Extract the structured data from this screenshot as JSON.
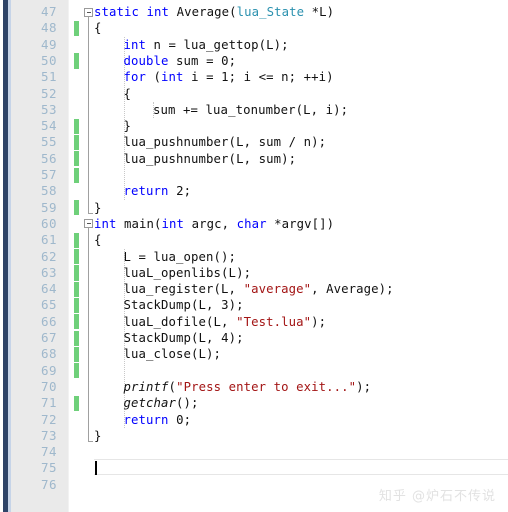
{
  "editor": {
    "app": "visual-studio-code-editor",
    "language": "C",
    "first_visible_line": 47,
    "last_visible_line": 76,
    "current_line": 75,
    "colors": {
      "background": "#ffffff",
      "gutter_background": "#eaeaea",
      "line_number": "#9fb8cc",
      "left_border_navy": "#2e4468",
      "left_border_pale": "#c6d4e8",
      "saved_change_marker": "#6fd07a",
      "keyword": "#0000ff",
      "type": "#2b91af",
      "string": "#a31515",
      "text": "#111111",
      "fold_marker_border": "#9a9a9a",
      "indent_guide": "#c8c8c8",
      "watermark": "#e2e2e2"
    },
    "lines": [
      {
        "n": "47",
        "indent": 0,
        "fold": true,
        "changed": false,
        "tokens": [
          {
            "t": "static",
            "c": "kw"
          },
          {
            "t": " ",
            "c": ""
          },
          {
            "t": "int",
            "c": "kw"
          },
          {
            "t": " Average(",
            "c": ""
          },
          {
            "t": "lua_State",
            "c": "typ"
          },
          {
            "t": " *L)",
            "c": ""
          }
        ]
      },
      {
        "n": "48",
        "indent": 0,
        "fold": false,
        "changed": true,
        "tokens": [
          {
            "t": "{",
            "c": ""
          }
        ]
      },
      {
        "n": "49",
        "indent": 1,
        "fold": false,
        "changed": false,
        "tokens": [
          {
            "t": "int",
            "c": "kw"
          },
          {
            "t": " n = lua_gettop(L);",
            "c": ""
          }
        ]
      },
      {
        "n": "50",
        "indent": 1,
        "fold": false,
        "changed": true,
        "tokens": [
          {
            "t": "double",
            "c": "kw"
          },
          {
            "t": " sum = ",
            "c": ""
          },
          {
            "t": "0",
            "c": "num"
          },
          {
            "t": ";",
            "c": ""
          }
        ]
      },
      {
        "n": "51",
        "indent": 1,
        "fold": false,
        "changed": false,
        "tokens": [
          {
            "t": "for",
            "c": "kw"
          },
          {
            "t": " (",
            "c": ""
          },
          {
            "t": "int",
            "c": "kw"
          },
          {
            "t": " i = ",
            "c": ""
          },
          {
            "t": "1",
            "c": "num"
          },
          {
            "t": "; i <= n; ++i)",
            "c": ""
          }
        ]
      },
      {
        "n": "52",
        "indent": 1,
        "fold": false,
        "changed": false,
        "tokens": [
          {
            "t": "{",
            "c": ""
          }
        ]
      },
      {
        "n": "53",
        "indent": 2,
        "fold": false,
        "changed": false,
        "tokens": [
          {
            "t": "sum += lua_tonumber(L, i);",
            "c": ""
          }
        ]
      },
      {
        "n": "54",
        "indent": 1,
        "fold": false,
        "changed": true,
        "tokens": [
          {
            "t": "}",
            "c": ""
          }
        ]
      },
      {
        "n": "55",
        "indent": 1,
        "fold": false,
        "changed": true,
        "tokens": [
          {
            "t": "lua_pushnumber(L, sum / n);",
            "c": ""
          }
        ]
      },
      {
        "n": "56",
        "indent": 1,
        "fold": false,
        "changed": true,
        "tokens": [
          {
            "t": "lua_pushnumber(L, sum);",
            "c": ""
          }
        ]
      },
      {
        "n": "57",
        "indent": 1,
        "fold": false,
        "changed": true,
        "tokens": []
      },
      {
        "n": "58",
        "indent": 1,
        "fold": false,
        "changed": false,
        "tokens": [
          {
            "t": "return",
            "c": "kw"
          },
          {
            "t": " ",
            "c": ""
          },
          {
            "t": "2",
            "c": "num"
          },
          {
            "t": ";",
            "c": ""
          }
        ]
      },
      {
        "n": "59",
        "indent": 0,
        "fold": false,
        "changed": true,
        "tokens": [
          {
            "t": "}",
            "c": ""
          }
        ]
      },
      {
        "n": "60",
        "indent": 0,
        "fold": true,
        "changed": false,
        "tokens": [
          {
            "t": "int",
            "c": "kw"
          },
          {
            "t": " main(",
            "c": ""
          },
          {
            "t": "int",
            "c": "kw"
          },
          {
            "t": " argc, ",
            "c": ""
          },
          {
            "t": "char",
            "c": "kw"
          },
          {
            "t": " *argv[])",
            "c": ""
          }
        ]
      },
      {
        "n": "61",
        "indent": 0,
        "fold": false,
        "changed": true,
        "tokens": [
          {
            "t": "{",
            "c": ""
          }
        ]
      },
      {
        "n": "62",
        "indent": 1,
        "fold": false,
        "changed": true,
        "tokens": [
          {
            "t": "L = lua_open();",
            "c": ""
          }
        ]
      },
      {
        "n": "63",
        "indent": 1,
        "fold": false,
        "changed": true,
        "tokens": [
          {
            "t": "luaL_openlibs(L);",
            "c": ""
          }
        ]
      },
      {
        "n": "64",
        "indent": 1,
        "fold": false,
        "changed": true,
        "tokens": [
          {
            "t": "lua_register(L, ",
            "c": ""
          },
          {
            "t": "\"average\"",
            "c": "str"
          },
          {
            "t": ", Average);",
            "c": ""
          }
        ]
      },
      {
        "n": "65",
        "indent": 1,
        "fold": false,
        "changed": true,
        "tokens": [
          {
            "t": "StackDump(L, ",
            "c": ""
          },
          {
            "t": "3",
            "c": "num"
          },
          {
            "t": ");",
            "c": ""
          }
        ]
      },
      {
        "n": "66",
        "indent": 1,
        "fold": false,
        "changed": true,
        "tokens": [
          {
            "t": "luaL_dofile(L, ",
            "c": ""
          },
          {
            "t": "\"Test.lua\"",
            "c": "str"
          },
          {
            "t": ");",
            "c": ""
          }
        ]
      },
      {
        "n": "67",
        "indent": 1,
        "fold": false,
        "changed": true,
        "tokens": [
          {
            "t": "StackDump(L, ",
            "c": ""
          },
          {
            "t": "4",
            "c": "num"
          },
          {
            "t": ");",
            "c": ""
          }
        ]
      },
      {
        "n": "68",
        "indent": 1,
        "fold": false,
        "changed": true,
        "tokens": [
          {
            "t": "lua_close(L);",
            "c": ""
          }
        ]
      },
      {
        "n": "69",
        "indent": 1,
        "fold": false,
        "changed": true,
        "tokens": []
      },
      {
        "n": "70",
        "indent": 1,
        "fold": false,
        "changed": false,
        "tokens": [
          {
            "t": "printf",
            "c": "ital"
          },
          {
            "t": "(",
            "c": ""
          },
          {
            "t": "\"Press enter to exit...\"",
            "c": "str"
          },
          {
            "t": ");",
            "c": ""
          }
        ]
      },
      {
        "n": "71",
        "indent": 1,
        "fold": false,
        "changed": true,
        "tokens": [
          {
            "t": "getchar",
            "c": "ital"
          },
          {
            "t": "();",
            "c": ""
          }
        ]
      },
      {
        "n": "72",
        "indent": 1,
        "fold": false,
        "changed": false,
        "tokens": [
          {
            "t": "return",
            "c": "kw"
          },
          {
            "t": " ",
            "c": ""
          },
          {
            "t": "0",
            "c": "num"
          },
          {
            "t": ";",
            "c": ""
          }
        ]
      },
      {
        "n": "73",
        "indent": 0,
        "fold": false,
        "changed": false,
        "tokens": [
          {
            "t": "}",
            "c": ""
          }
        ]
      },
      {
        "n": "74",
        "indent": 0,
        "fold": false,
        "changed": false,
        "tokens": []
      },
      {
        "n": "75",
        "indent": 0,
        "fold": false,
        "changed": false,
        "tokens": []
      },
      {
        "n": "76",
        "indent": 0,
        "fold": false,
        "changed": false,
        "tokens": []
      }
    ]
  },
  "watermark": {
    "text": "知乎 @炉石不传说"
  }
}
